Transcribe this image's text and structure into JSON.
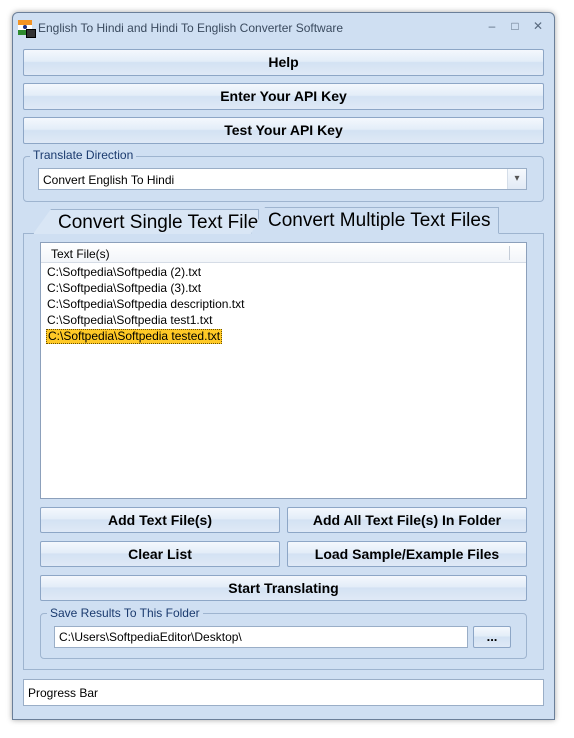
{
  "window": {
    "title": "English To Hindi and Hindi To English Converter Software",
    "minimize_glyph": "–",
    "maximize_glyph": "□",
    "close_glyph": "✕"
  },
  "buttons": {
    "help": "Help",
    "enter_api_key": "Enter Your API Key",
    "test_api_key": "Test Your API Key"
  },
  "translate_direction": {
    "label": "Translate Direction",
    "selected": "Convert English To Hindi",
    "arrow": "▾"
  },
  "tabs": [
    {
      "label": "Convert Single Text File",
      "active": false
    },
    {
      "label": "Convert Multiple Text Files",
      "active": true
    }
  ],
  "file_list": {
    "column_header": "Text File(s)",
    "items": [
      {
        "path": "C:\\Softpedia\\Softpedia (2).txt",
        "selected": false
      },
      {
        "path": "C:\\Softpedia\\Softpedia (3).txt",
        "selected": false
      },
      {
        "path": "C:\\Softpedia\\Softpedia description.txt",
        "selected": false
      },
      {
        "path": "C:\\Softpedia\\Softpedia test1.txt",
        "selected": false
      },
      {
        "path": "C:\\Softpedia\\Softpedia tested.txt",
        "selected": true
      }
    ]
  },
  "actions": {
    "add_files": "Add Text File(s)",
    "add_folder": "Add All Text File(s) In Folder",
    "clear_list": "Clear List",
    "load_samples": "Load Sample/Example Files",
    "start": "Start Translating"
  },
  "save_results": {
    "label": "Save Results To This Folder",
    "path": "C:\\Users\\SoftpediaEditor\\Desktop\\",
    "browse": "..."
  },
  "progress": {
    "label": "Progress Bar"
  },
  "colors": {
    "window_bg": "#cfdff2",
    "selection": "#ffc926",
    "group_label": "#1a3a6e"
  }
}
